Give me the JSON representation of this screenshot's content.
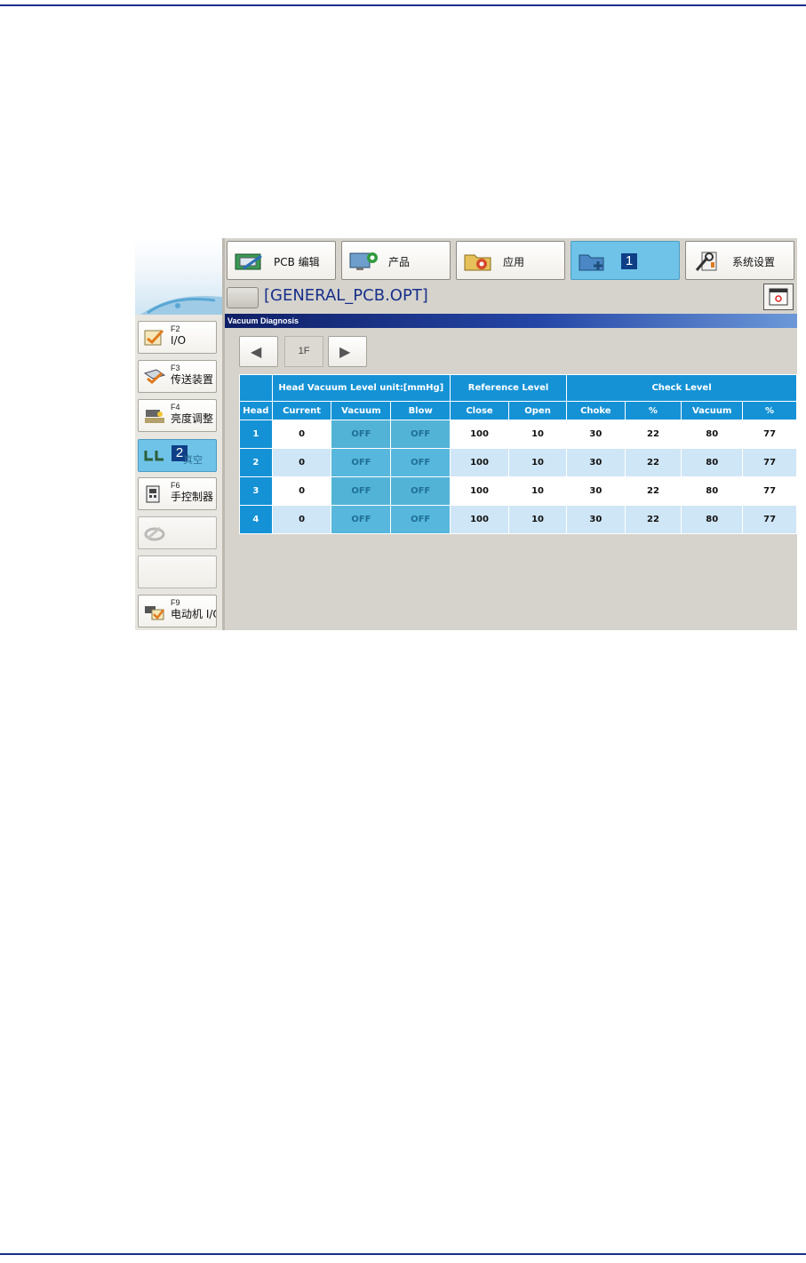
{
  "topbar": {
    "buttons": [
      {
        "label": "PCB 编辑",
        "icon": "pcb-edit-icon"
      },
      {
        "label": "产品",
        "icon": "product-icon"
      },
      {
        "label": "应用",
        "icon": "application-icon"
      },
      {
        "label": "",
        "icon": "folder-add-icon",
        "badge": "1",
        "active": true
      },
      {
        "label": "系统设置",
        "icon": "system-settings-icon"
      }
    ]
  },
  "filebar": {
    "file_name": "[GENERAL_PCB.OPT]"
  },
  "sidebar": {
    "items": [
      {
        "key": "F2",
        "label": "I/O",
        "icon": "io-check-icon"
      },
      {
        "key": "F3",
        "label": "传送装置",
        "icon": "conveyor-icon"
      },
      {
        "key": "F4",
        "label": "亮度调整",
        "icon": "brightness-icon"
      },
      {
        "key": "",
        "label": "",
        "badge": "2",
        "ghost": "真空",
        "icon": "vacuum-icon",
        "active": true
      },
      {
        "key": "F6",
        "label": "手控制器",
        "icon": "controller-icon"
      },
      {
        "key": "",
        "label": "",
        "icon": "disabled-tool-icon",
        "disabled": true
      },
      {
        "key": "",
        "label": "",
        "icon": "",
        "disabled": true
      },
      {
        "key": "F9",
        "label": "电动机 I/O",
        "icon": "motor-io-icon"
      }
    ]
  },
  "panel": {
    "title": "Vacuum Diagnosis",
    "floor": "1F",
    "prev_icon": "arrow-left-icon",
    "next_icon": "arrow-right-icon"
  },
  "table": {
    "groups": {
      "head_vacuum": "Head Vacuum Level unit:[mmHg]",
      "reference": "Reference Level",
      "check": "Check Level"
    },
    "columns": {
      "head": "Head",
      "current": "Current",
      "vacuum": "Vacuum",
      "blow": "Blow",
      "close": "Close",
      "open": "Open",
      "choke": "Choke",
      "choke_pct": "%",
      "check_vacuum": "Vacuum",
      "vacuum_pct": "%"
    },
    "rows": [
      {
        "head": "1",
        "current": "0",
        "vacuum": "OFF",
        "blow": "OFF",
        "close": "100",
        "open": "10",
        "choke": "30",
        "choke_pct": "22",
        "check_vacuum": "80",
        "vacuum_pct": "77"
      },
      {
        "head": "2",
        "current": "0",
        "vacuum": "OFF",
        "blow": "OFF",
        "close": "100",
        "open": "10",
        "choke": "30",
        "choke_pct": "22",
        "check_vacuum": "80",
        "vacuum_pct": "77"
      },
      {
        "head": "3",
        "current": "0",
        "vacuum": "OFF",
        "blow": "OFF",
        "close": "100",
        "open": "10",
        "choke": "30",
        "choke_pct": "22",
        "check_vacuum": "80",
        "vacuum_pct": "77"
      },
      {
        "head": "4",
        "current": "0",
        "vacuum": "OFF",
        "blow": "OFF",
        "close": "100",
        "open": "10",
        "choke": "30",
        "choke_pct": "22",
        "check_vacuum": "80",
        "vacuum_pct": "77"
      }
    ]
  },
  "colors": {
    "accent_blue": "#1592d6",
    "active_button": "#6fc3e8",
    "title_bar": "#0f1f66",
    "page_rule": "#1a2f8a"
  }
}
